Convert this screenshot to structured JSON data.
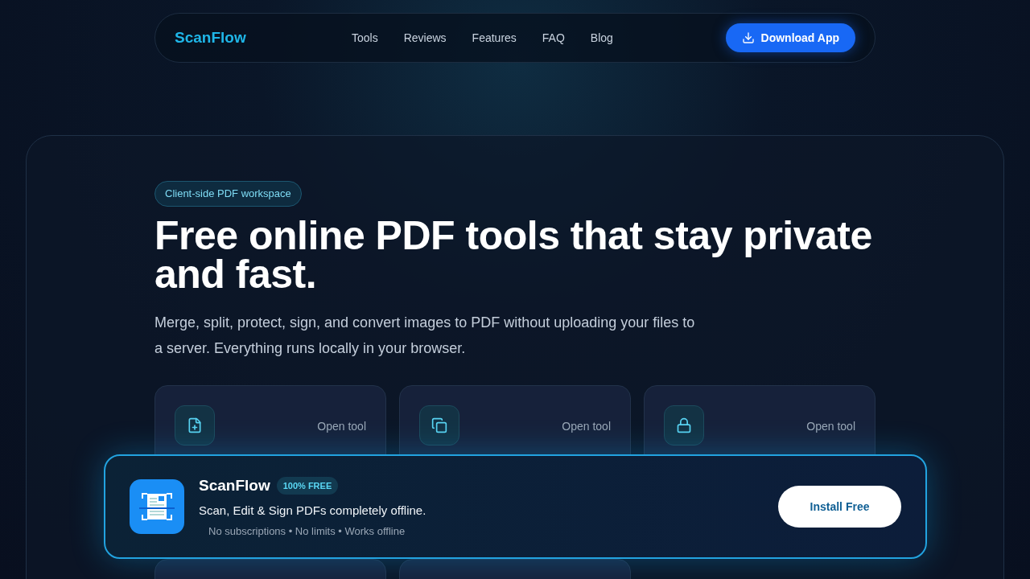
{
  "nav": {
    "brand": "ScanFlow",
    "links": [
      "Tools",
      "Reviews",
      "Features",
      "FAQ",
      "Blog"
    ],
    "cta": "Download App"
  },
  "hero": {
    "badge": "Client-side PDF workspace",
    "title": "Free online PDF tools that stay private and fast.",
    "subtitle": "Merge, split, protect, sign, and convert images to PDF without uploading your files to a server. Everything runs locally in your browser."
  },
  "cards": [
    {
      "action": "Open tool"
    },
    {
      "action": "Open tool"
    },
    {
      "action": "Open tool"
    }
  ],
  "banner": {
    "name": "ScanFlow",
    "tag": "100% FREE",
    "tagline": "Scan, Edit & Sign PDFs completely offline.",
    "features": "No subscriptions • No limits • Works offline",
    "button": "Install Free"
  }
}
